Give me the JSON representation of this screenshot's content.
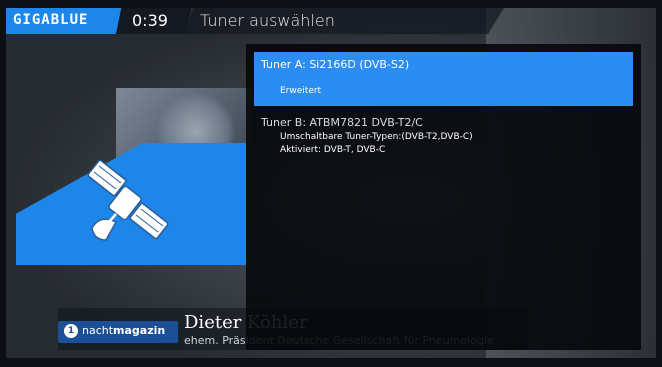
{
  "header": {
    "logo": "GIGABLUE",
    "time": "0:39",
    "title": "Tuner auswählen"
  },
  "tuners": [
    {
      "title": "Tuner A: Si2166D (DVB-S2)",
      "detail": "Erweitert",
      "selected": true
    },
    {
      "title": "Tuner B: ATBM7821 DVB-T2/C",
      "line1": "Umschaltbare Tuner-Typen:(DVB-T2,DVB-C)",
      "line2": "Aktiviert: DVB-T, DVB-C",
      "selected": false
    }
  ],
  "lower_third": {
    "channel_regular": "nacht",
    "channel_bold": "magazin",
    "name": "Dieter Köhler",
    "role": "ehem. Präsident Deutsche Gesellschaft für Pneumologie"
  },
  "colors": {
    "accent": "#1f86e9",
    "selected_row": "#2b8cf2",
    "dialog_bg": "#06080b"
  },
  "icons": {
    "banner": "satellite-icon",
    "channel": "ard-logo-icon"
  }
}
